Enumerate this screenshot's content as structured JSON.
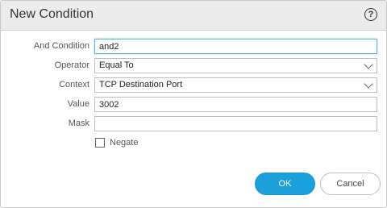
{
  "dialog": {
    "title": "New Condition",
    "help_symbol": "?"
  },
  "form": {
    "and_condition": {
      "label": "And Condition",
      "value": "and2"
    },
    "operator": {
      "label": "Operator",
      "value": "Equal To"
    },
    "context": {
      "label": "Context",
      "value": "TCP Destination Port"
    },
    "value": {
      "label": "Value",
      "value": "3002"
    },
    "mask": {
      "label": "Mask",
      "value": ""
    },
    "negate": {
      "label": "Negate",
      "checked": false
    }
  },
  "buttons": {
    "ok": "OK",
    "cancel": "Cancel"
  },
  "icons": {
    "help": "help-circle-icon",
    "dropdown": "chevron-down-icon"
  },
  "colors": {
    "primary": "#1ca0dc",
    "focus": "#5fb6d3"
  }
}
